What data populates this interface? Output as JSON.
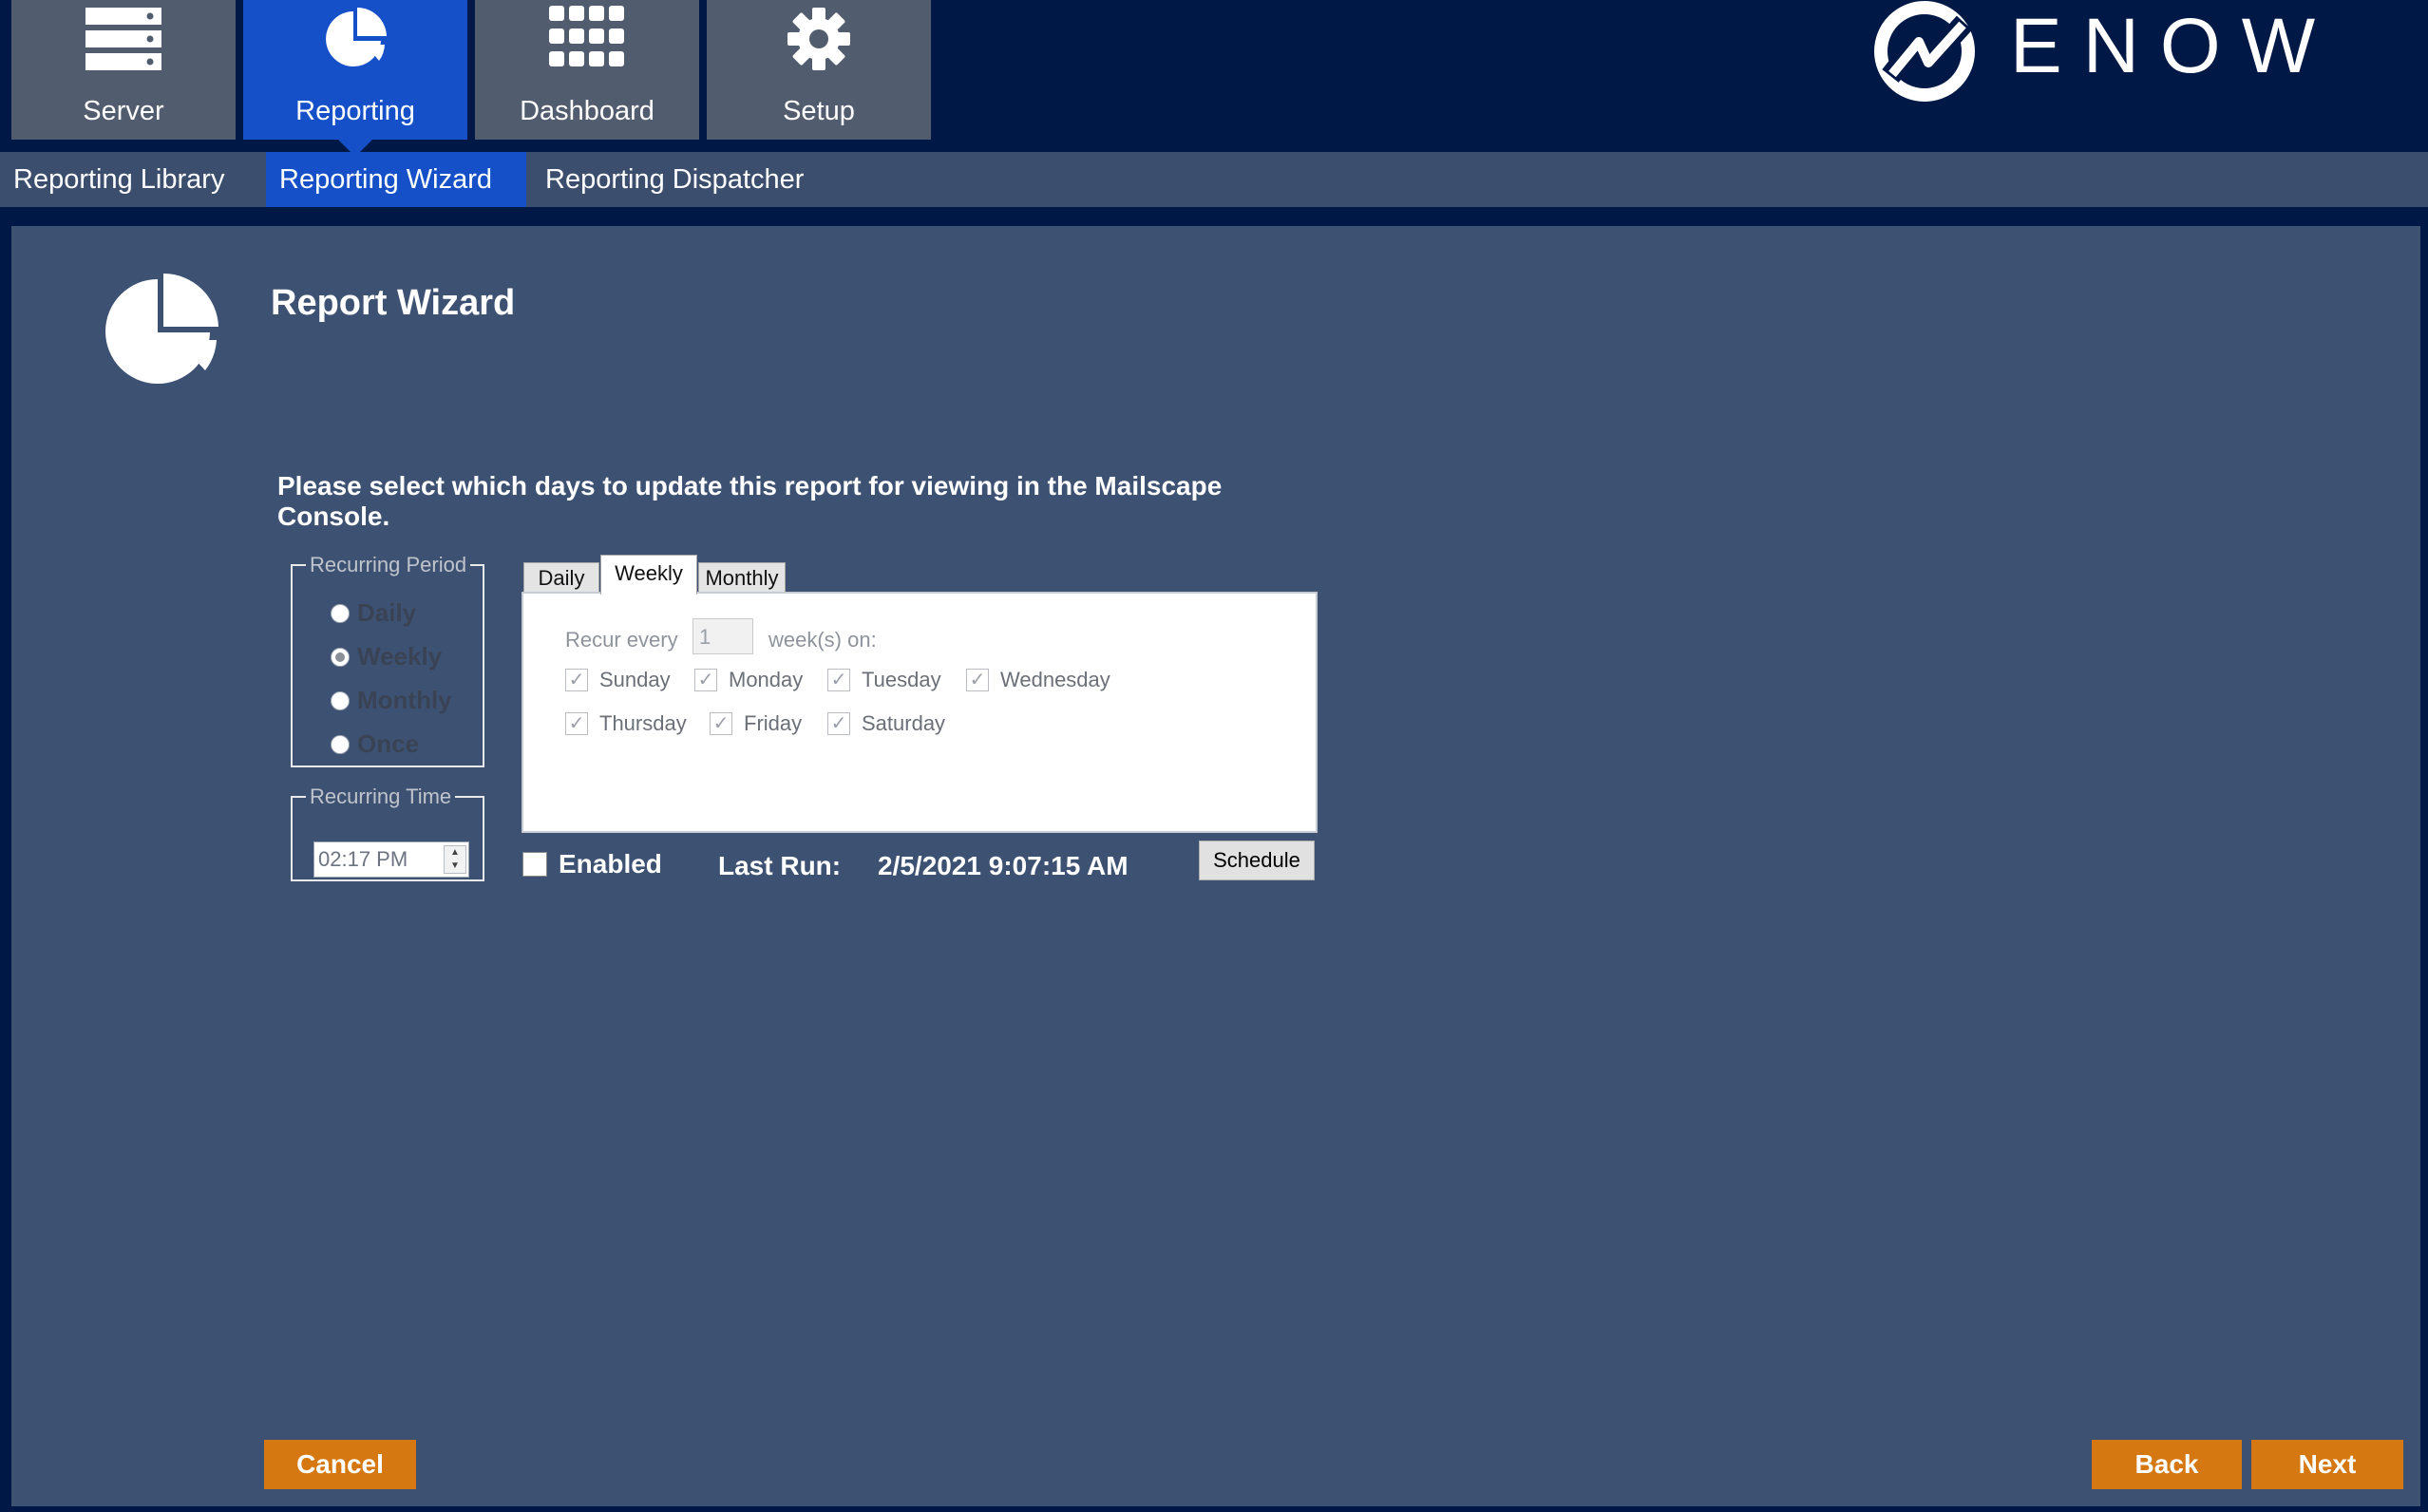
{
  "nav": {
    "tabs": [
      {
        "label": "Server",
        "icon": "server-icon"
      },
      {
        "label": "Reporting",
        "icon": "pie-chart-icon"
      },
      {
        "label": "Dashboard",
        "icon": "grid-icon"
      },
      {
        "label": "Setup",
        "icon": "gear-icon"
      }
    ],
    "active_tab": "Reporting"
  },
  "brand": {
    "name": "ENOW",
    "color": "#001846",
    "accent": "#1550c8"
  },
  "subnav": {
    "tabs": [
      "Reporting Library",
      "Reporting Wizard",
      "Reporting Dispatcher"
    ],
    "active": "Reporting Wizard"
  },
  "wizard": {
    "title": "Report Wizard",
    "instruction": "Please select which days to update this report for viewing in the Mailscape Console.",
    "recurring_period": {
      "legend": "Recurring Period",
      "options": [
        "Daily",
        "Weekly",
        "Monthly",
        "Once"
      ],
      "selected": "Weekly"
    },
    "recurring_time": {
      "legend": "Recurring Time",
      "value": "02:17 PM"
    },
    "schedule_tabs": {
      "tabs": [
        "Daily",
        "Weekly",
        "Monthly"
      ],
      "active": "Weekly"
    },
    "weekly": {
      "recur_every_label": "Recur every",
      "recur_every_value": "1",
      "weeks_on_label": "week(s) on:",
      "days": [
        "Sunday",
        "Monday",
        "Tuesday",
        "Wednesday",
        "Thursday",
        "Friday",
        "Saturday"
      ]
    },
    "enabled_label": "Enabled",
    "last_run_label": "Last Run:",
    "last_run_value": "2/5/2021 9:07:15 AM",
    "schedule_button": "Schedule"
  },
  "footer": {
    "cancel": "Cancel",
    "back": "Back",
    "next": "Next",
    "button_color": "#d67812"
  }
}
